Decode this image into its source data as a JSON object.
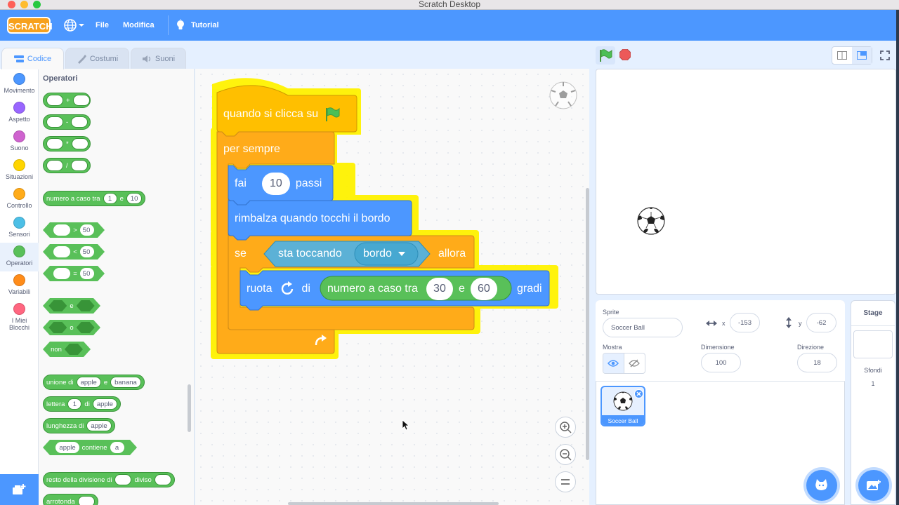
{
  "window": {
    "title": "Scratch Desktop"
  },
  "menubar": {
    "logo": "SCRATCH",
    "file": "File",
    "edit": "Modifica",
    "tutorial": "Tutorial"
  },
  "tabs": {
    "code": "Codice",
    "costumes": "Costumi",
    "sounds": "Suoni"
  },
  "categories": [
    {
      "label": "Movimento",
      "color": "#4c97ff"
    },
    {
      "label": "Aspetto",
      "color": "#9966ff"
    },
    {
      "label": "Suono",
      "color": "#cf63cf"
    },
    {
      "label": "Situazioni",
      "color": "#ffd500"
    },
    {
      "label": "Controllo",
      "color": "#ffab19"
    },
    {
      "label": "Sensori",
      "color": "#4cbfe6"
    },
    {
      "label": "Operatori",
      "color": "#59c059"
    },
    {
      "label": "Variabili",
      "color": "#ff8c1a"
    },
    {
      "label": "I Miei Blocchi",
      "color": "#ff6680"
    }
  ],
  "palette": {
    "heading": "Operatori",
    "op_add": "+",
    "op_sub": "-",
    "op_mul": "*",
    "op_div": "/",
    "random_label": "numero a caso tra",
    "random_from": "1",
    "random_and": "e",
    "random_to": "10",
    "gt": ">",
    "lt": "<",
    "eq": "=",
    "cmp_value": "50",
    "and": "e",
    "or": "o",
    "not": "non",
    "join_label": "unione di",
    "join_a": "apple",
    "join_and": "e",
    "join_b": "banana",
    "letter_label": "lettera",
    "letter_n": "1",
    "letter_of": "di",
    "letter_word": "apple",
    "length_label": "lunghezza di",
    "length_word": "apple",
    "contains_word": "apple",
    "contains_label": "contiene",
    "contains_char": "a",
    "mod_label": "resto della divisione di",
    "mod_div": "diviso",
    "round_label": "arrotonda"
  },
  "script": {
    "hat": "quando si clicca su",
    "forever": "per sempre",
    "move_label": "fai",
    "move_steps": "10",
    "move_unit": "passi",
    "bounce": "rimbalza quando tocchi il bordo",
    "if_label": "se",
    "touching_label": "sta toccando",
    "touching_target": "bordo",
    "then_label": "allora",
    "turn_label": "ruota",
    "turn_of": "di",
    "random_label": "numero a caso tra",
    "random_from": "30",
    "random_and": "e",
    "random_to": "60",
    "turn_unit": "gradi"
  },
  "sprite_info": {
    "sprite_label": "Sprite",
    "sprite_name": "Soccer Ball",
    "x_label": "x",
    "x_value": "-153",
    "y_label": "y",
    "y_value": "-62",
    "show_label": "Mostra",
    "size_label": "Dimensione",
    "size_value": "100",
    "direction_label": "Direzione",
    "direction_value": "18"
  },
  "sprites": [
    {
      "name": "Soccer Ball"
    }
  ],
  "stage_panel": {
    "title": "Stage",
    "backdrops_label": "Sfondi",
    "backdrops_count": "1"
  },
  "colors": {
    "accent": "#4c97ff",
    "motion": "#4c97ff",
    "control": "#ffab19",
    "events": "#ffbf00",
    "operators": "#59c059",
    "sensing": "#5cb1d6",
    "glow": "#fff200"
  }
}
